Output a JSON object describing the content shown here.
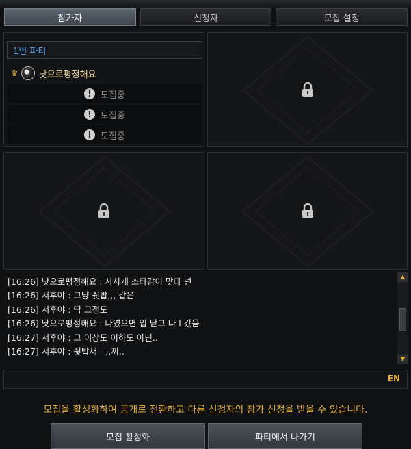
{
  "tabs": [
    {
      "label": "참가자",
      "active": true
    },
    {
      "label": "신청자",
      "active": false
    },
    {
      "label": "모집 설정",
      "active": false
    }
  ],
  "party": {
    "header": "1번 파티",
    "leader": {
      "name": "낫으로평정해요",
      "crown_icon": "crown-icon",
      "class_icon": "class-emblem-icon"
    },
    "slots": [
      {
        "status": "모집중"
      },
      {
        "status": "모집중"
      },
      {
        "status": "모집중"
      }
    ]
  },
  "locked_slots": 3,
  "chat": {
    "lines": [
      "[16:26] 낫으로평정해요 : 사사게 스타감이 맞다 넌",
      "[16:26] 서후야 : 그냥 쥣밥,,, 같은",
      "[16:26] 서후야 : 딱 그정도",
      "[16:26] 낫으로평정해요 : 나였으면 입 닫고 나 l 갔음",
      "[16:27] 서후야 : 그 이상도 이하도 아닌..",
      "[16:27] 서후야 : 쥣밥새—..끼.."
    ],
    "input_placeholder": "",
    "lang": "EN"
  },
  "notice": "모집을 활성화하여 공개로 전환하고 다른 신청자의 참가 신청을 받을 수 있습니다.",
  "buttons": {
    "activate": "모집 활성화",
    "leave": "파티에서 나가기"
  },
  "colors": {
    "accent_gold": "#e1ad3f",
    "party_header_blue": "#5aa2e6",
    "leader_name": "#f2d79a"
  }
}
